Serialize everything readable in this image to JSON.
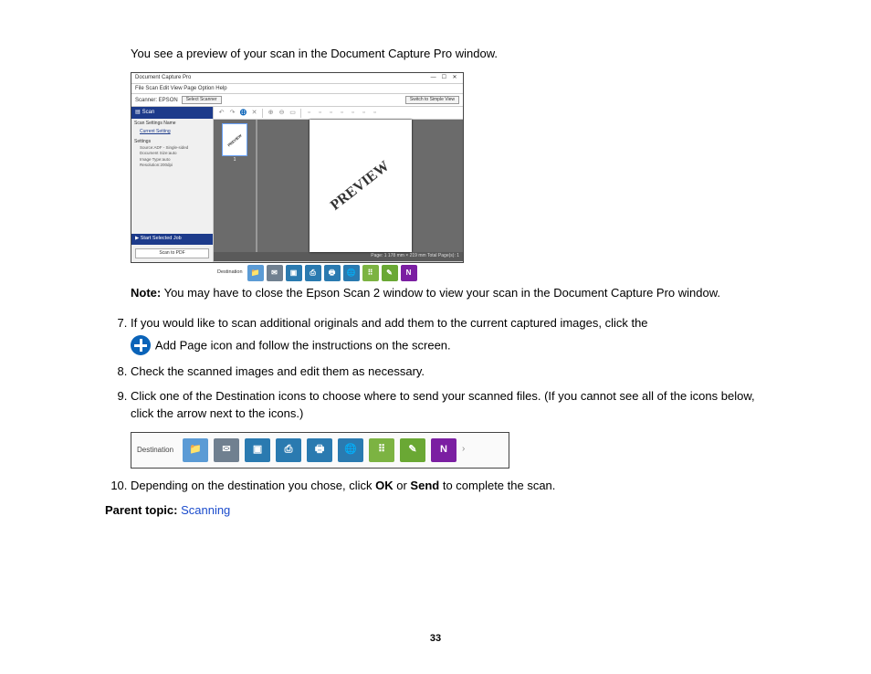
{
  "intro": "You see a preview of your scan in the Document Capture Pro window.",
  "app": {
    "title": "Document Capture Pro",
    "menu": "File   Scan   Edit   View   Page   Option   Help",
    "scanner_label": "Scanner:  EPSON",
    "select_scanner_btn": "Select Scanner",
    "switch_btn": "Switch to Simple View",
    "sb_scan": "Scan",
    "sb_settings_header": "Scan Settings Name",
    "sb_settings_link": "Current Setting",
    "sb_sub": "Settings",
    "sb_line1": "Source:ADF - Single-sided",
    "sb_line2": "Document Size:auto",
    "sb_line3": "Image Type:auto",
    "sb_line4": "Resolution:200dpi",
    "sb_start": "Start Selected Job",
    "sb_savebtn": "Scan to PDF",
    "page_label": "PREVIEW",
    "thumb_label": "PREVIEW",
    "thumb_num": "1",
    "status": "Page: 1   178 mm × 219 mm   Total Page(s): 1",
    "dest_label": "Destination"
  },
  "note_label": "Note:",
  "note_text": " You may have to close the Epson Scan 2 window to view your scan in the Document Capture Pro window.",
  "step7a": "If you would like to scan additional originals and add them to the current captured images, click the",
  "step7b": " Add Page icon and follow the instructions on the screen.",
  "step8": "Check the scanned images and edit them as necessary.",
  "step9": "Click one of the Destination icons to choose where to send your scanned files. (If you cannot see all of the icons below, click the arrow next to the icons.)",
  "dest2_label": "Destination",
  "step10a": "Depending on the destination you chose, click ",
  "step10_ok": "OK",
  "step10b": " or ",
  "step10_send": "Send",
  "step10c": " to complete the scan.",
  "parent_label": "Parent topic: ",
  "parent_link": "Scanning",
  "pagenum": "33",
  "icons": {
    "folder": "📁",
    "mail": "✉",
    "cloud": "▣",
    "ftp": "⎙",
    "print": "🖶",
    "web": "🌐",
    "sp": "⠿",
    "ever": "✎",
    "onen": "N"
  }
}
